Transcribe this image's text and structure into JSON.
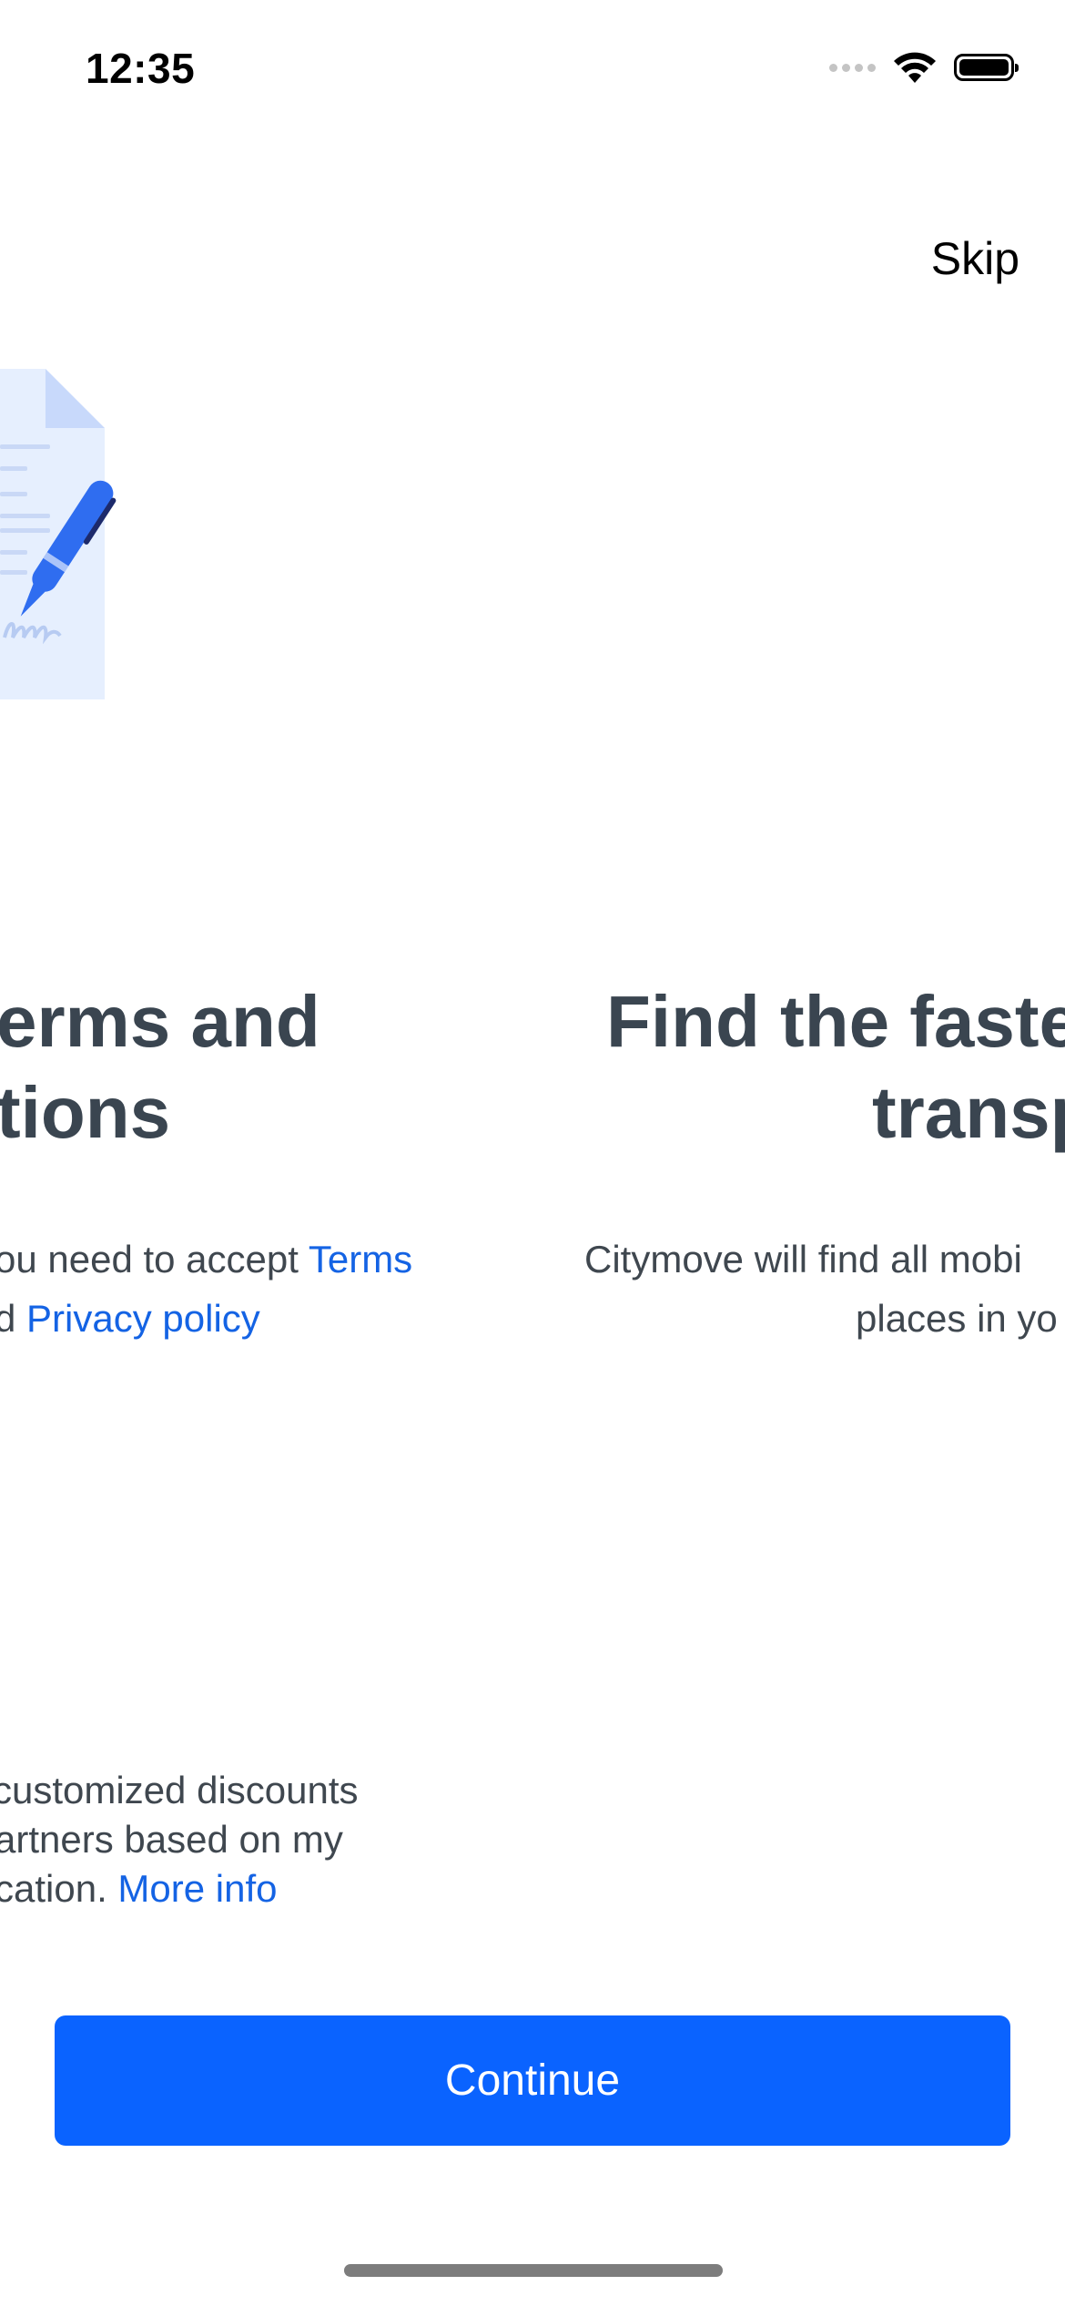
{
  "status_bar": {
    "time": "12:35"
  },
  "header": {
    "skip_label": "Skip"
  },
  "slide_left": {
    "title_line1": "erms and",
    "title_line2": "tions",
    "text_line1_prefix": "ou need to accept ",
    "terms_link": "Terms",
    "text_line2_prefix": "d ",
    "privacy_link": "Privacy policy",
    "consent_line1": " customized discounts",
    "consent_line2": "artners based on my",
    "consent_line3_prefix": "cation. ",
    "more_info_link": "More info"
  },
  "slide_right": {
    "title_line1": "Find the faste",
    "title_line2": "transp",
    "text_line1": "Citymove will find all mobi",
    "text_line2": "places in yo"
  },
  "footer": {
    "continue_label": "Continue"
  },
  "colors": {
    "accent": "#0a63ff",
    "link": "#1463e4",
    "title": "#3a4550"
  }
}
